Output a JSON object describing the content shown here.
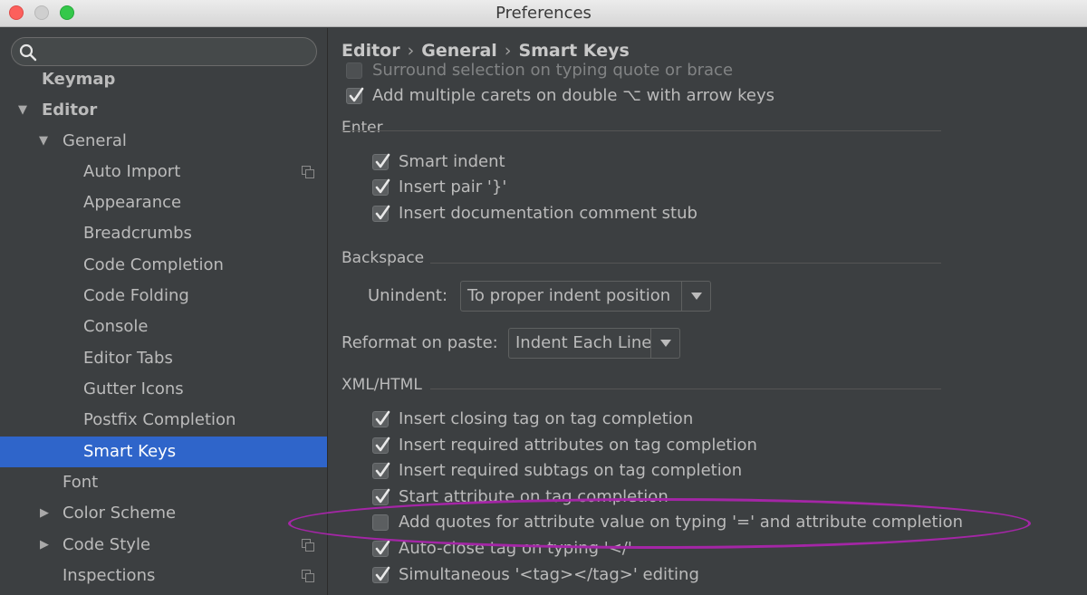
{
  "window": {
    "title": "Preferences"
  },
  "search": {
    "placeholder": "",
    "value": ""
  },
  "sidebar": {
    "items": [
      {
        "label": "Keymap"
      },
      {
        "label": "Editor"
      },
      {
        "label": "General"
      },
      {
        "label": "Auto Import"
      },
      {
        "label": "Appearance"
      },
      {
        "label": "Breadcrumbs"
      },
      {
        "label": "Code Completion"
      },
      {
        "label": "Code Folding"
      },
      {
        "label": "Console"
      },
      {
        "label": "Editor Tabs"
      },
      {
        "label": "Gutter Icons"
      },
      {
        "label": "Postfix Completion"
      },
      {
        "label": "Smart Keys"
      },
      {
        "label": "Font"
      },
      {
        "label": "Color Scheme"
      },
      {
        "label": "Code Style"
      },
      {
        "label": "Inspections"
      }
    ],
    "selected": "Smart Keys"
  },
  "breadcrumb": {
    "parts": [
      "Editor",
      "General",
      "Smart Keys"
    ]
  },
  "options_top": [
    {
      "label": "Surround selection on typing quote or brace",
      "checked": false
    },
    {
      "label": "Add multiple carets on double ⌥ with arrow keys",
      "checked": true
    }
  ],
  "sections": {
    "enter": "Enter",
    "backspace": "Backspace",
    "xml": "XML/HTML"
  },
  "enter_options": [
    {
      "label": "Smart indent",
      "checked": true
    },
    {
      "label": "Insert pair '}'",
      "checked": true
    },
    {
      "label": "Insert documentation comment stub",
      "checked": true
    }
  ],
  "unindent": {
    "label": "Unindent:",
    "value": "To proper indent position"
  },
  "reformat": {
    "label": "Reformat on paste:",
    "value": "Indent Each Line"
  },
  "xml_options": [
    {
      "label": "Insert closing tag on tag completion",
      "checked": true
    },
    {
      "label": "Insert required attributes on tag completion",
      "checked": true
    },
    {
      "label": "Insert required subtags on tag completion",
      "checked": true
    },
    {
      "label": "Start attribute on tag completion",
      "checked": true
    },
    {
      "label": "Add quotes for attribute value on typing '=' and attribute completion",
      "checked": false
    },
    {
      "label": "Auto-close tag on typing '</'",
      "checked": true
    },
    {
      "label": "Simultaneous '<tag></tag>' editing",
      "checked": true
    }
  ],
  "colors": {
    "selection": "#2f65ca",
    "highlight_ellipse": "#a426a6"
  }
}
